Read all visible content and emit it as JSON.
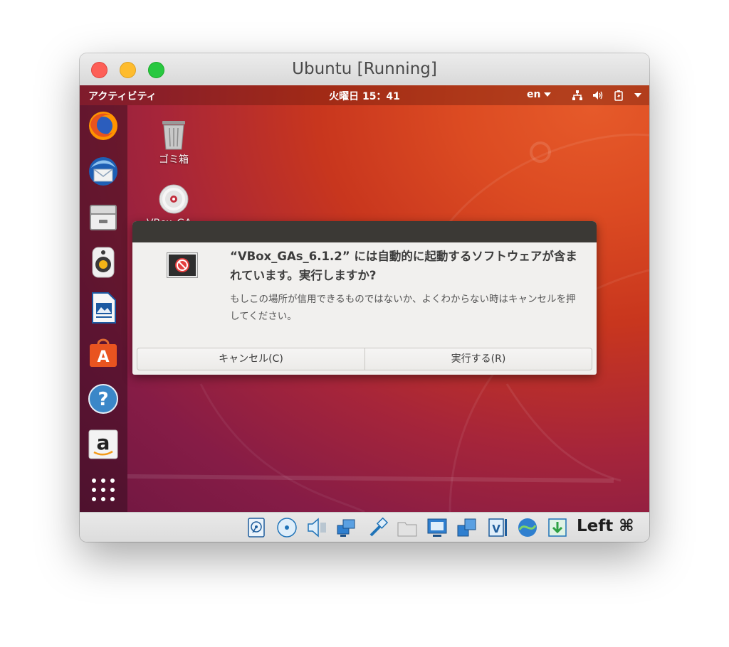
{
  "window": {
    "title": "Ubuntu [Running]"
  },
  "topbar": {
    "activities": "アクティビティ",
    "clock": "火曜日 15：41",
    "language": "en"
  },
  "dock": {
    "items": [
      {
        "name": "Firefox"
      },
      {
        "name": "Thunderbird"
      },
      {
        "name": "Files"
      },
      {
        "name": "Rhythmbox"
      },
      {
        "name": "LibreOffice Writer"
      },
      {
        "name": "Ubuntu Software"
      },
      {
        "name": "Help"
      },
      {
        "name": "Amazon"
      },
      {
        "name": "Show Applications"
      }
    ]
  },
  "desktop": {
    "trash_label": "ゴミ箱",
    "disc_label": "VBox_GA..."
  },
  "dialog": {
    "title": "“VBox_GAs_6.1.2” には自動的に起動するソフトウェアが含まれています。実行しますか?",
    "message": "もしこの場所が信用できるものではないか、よくわからない時はキャンセルを押してください。",
    "cancel_label": "キャンセル(C)",
    "run_label": "実行する(R)"
  },
  "statusbar": {
    "host_key": "Left ⌘"
  },
  "colors": {
    "accent": "#e95420",
    "dialog_header": "#3b3935"
  }
}
